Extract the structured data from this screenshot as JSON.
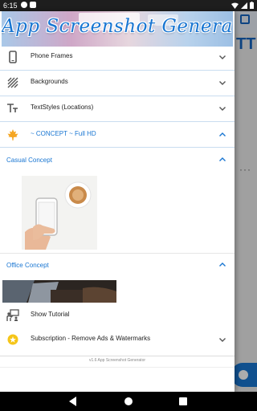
{
  "status_bar": {
    "time": "6:15"
  },
  "header": {
    "banner_title": "App Screenshot Generator"
  },
  "menu": [
    {
      "label": "Phone Frames",
      "icon": "phone-icon"
    },
    {
      "label": "Backgrounds",
      "icon": "hatch-pattern-icon"
    },
    {
      "label": "TextStyles (Locations)",
      "icon": "text-style-icon"
    },
    {
      "label": "~ CONCEPT ~ Full HD",
      "icon": "maple-leaf-icon"
    }
  ],
  "concepts": {
    "casual": {
      "title": "Casual Concept"
    },
    "office": {
      "title": "Office Concept"
    }
  },
  "tutorial": {
    "label": "Show Tutorial",
    "icon": "presentation-icon"
  },
  "subscription": {
    "label": "Subscription - Remove Ads & Watermarks",
    "icon": "star-badge-icon"
  },
  "footer": {
    "version": "v1.6 App Screenshot Generator"
  },
  "background_app": {
    "toolbar_text_icon": "TT",
    "dots": "···"
  },
  "colors": {
    "accent": "#1976d2",
    "divider": "#c9ddf0",
    "concept_icon": "#f5a623",
    "status_bar": "#1e1e1e"
  }
}
